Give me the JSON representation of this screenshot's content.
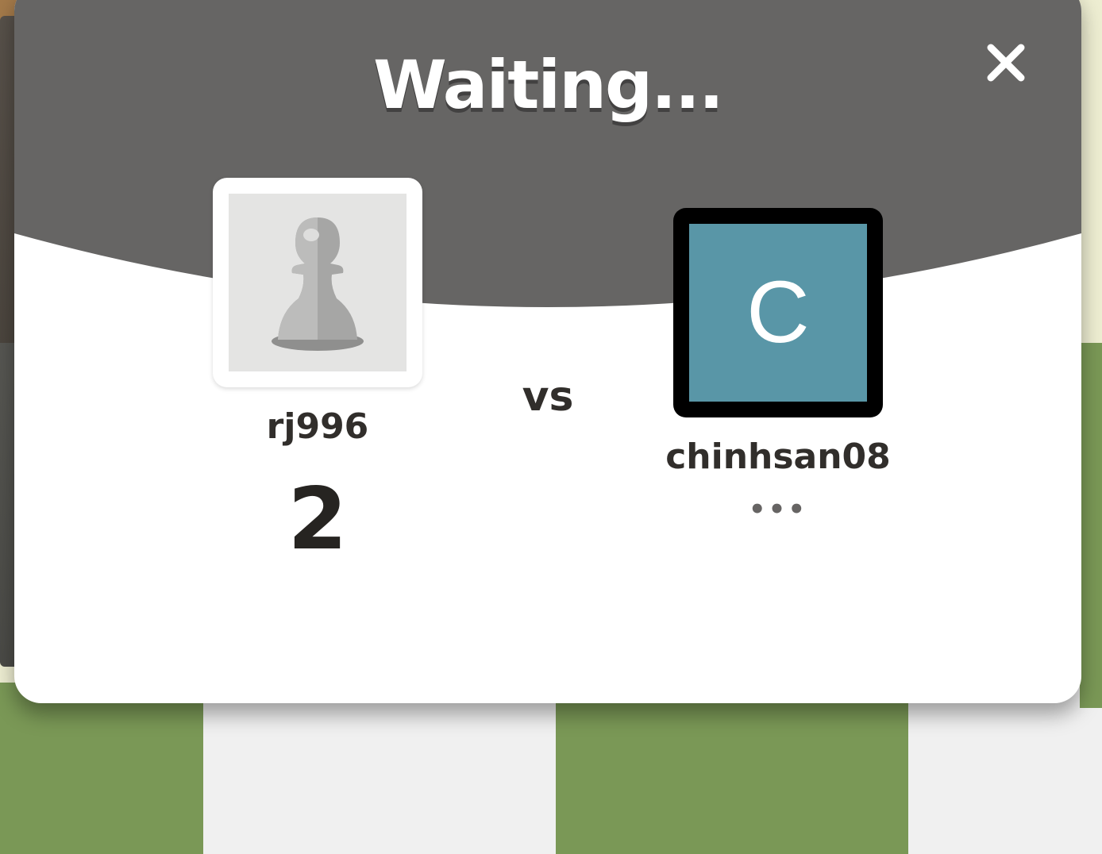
{
  "modal": {
    "title": "Waiting...",
    "close_icon": "close-icon"
  },
  "players": {
    "left": {
      "username": "rj996",
      "score": "2",
      "avatar_icon": "pawn-icon"
    },
    "right": {
      "username": "chinhsan08",
      "avatar_initial": "C",
      "status": "•••"
    }
  },
  "vs_label": "vs",
  "colors": {
    "header": "#666564",
    "board_dark": "#7a9856",
    "board_light": "#f0f0f0",
    "avatar_right_bg": "#5996a7"
  }
}
